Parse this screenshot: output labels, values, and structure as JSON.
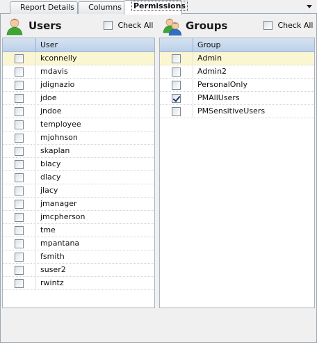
{
  "tabs": [
    {
      "label": "Report Details",
      "active": false
    },
    {
      "label": "Columns",
      "active": false
    },
    {
      "label": "Permissions",
      "active": true
    }
  ],
  "tab_overflow_icon": "chevron-down-icon",
  "users_panel": {
    "title": "Users",
    "icon": "user-icon",
    "check_all_label": "Check All",
    "check_all_checked": false,
    "column_header": "User",
    "rows": [
      {
        "name": "kconnelly",
        "checked": false,
        "selected": true
      },
      {
        "name": "mdavis",
        "checked": false,
        "selected": false
      },
      {
        "name": "jdignazio",
        "checked": false,
        "selected": false
      },
      {
        "name": "jdoe",
        "checked": false,
        "selected": false
      },
      {
        "name": "jndoe",
        "checked": false,
        "selected": false
      },
      {
        "name": "temployee",
        "checked": false,
        "selected": false
      },
      {
        "name": "mjohnson",
        "checked": false,
        "selected": false
      },
      {
        "name": "skaplan",
        "checked": false,
        "selected": false
      },
      {
        "name": "blacy",
        "checked": false,
        "selected": false
      },
      {
        "name": "dlacy",
        "checked": false,
        "selected": false
      },
      {
        "name": "jlacy",
        "checked": false,
        "selected": false
      },
      {
        "name": "jmanager",
        "checked": false,
        "selected": false
      },
      {
        "name": "jmcpherson",
        "checked": false,
        "selected": false
      },
      {
        "name": "tme",
        "checked": false,
        "selected": false
      },
      {
        "name": "mpantana",
        "checked": false,
        "selected": false
      },
      {
        "name": "fsmith",
        "checked": false,
        "selected": false
      },
      {
        "name": "suser2",
        "checked": false,
        "selected": false
      },
      {
        "name": "rwintz",
        "checked": false,
        "selected": false
      }
    ]
  },
  "groups_panel": {
    "title": "Groups",
    "icon": "group-icon",
    "check_all_label": "Check All",
    "check_all_checked": false,
    "column_header": "Group",
    "rows": [
      {
        "name": "Admin",
        "checked": false,
        "selected": true
      },
      {
        "name": "Admin2",
        "checked": false,
        "selected": false
      },
      {
        "name": "PersonalOnly",
        "checked": false,
        "selected": false
      },
      {
        "name": "PMAllUsers",
        "checked": true,
        "selected": false
      },
      {
        "name": "PMSensitiveUsers",
        "checked": false,
        "selected": false
      }
    ]
  },
  "colors": {
    "selected_row": "#fbf6d2",
    "header_gradient_top": "#d6e2f1",
    "header_gradient_bottom": "#bcd0ea",
    "border": "#9aa6b2"
  }
}
